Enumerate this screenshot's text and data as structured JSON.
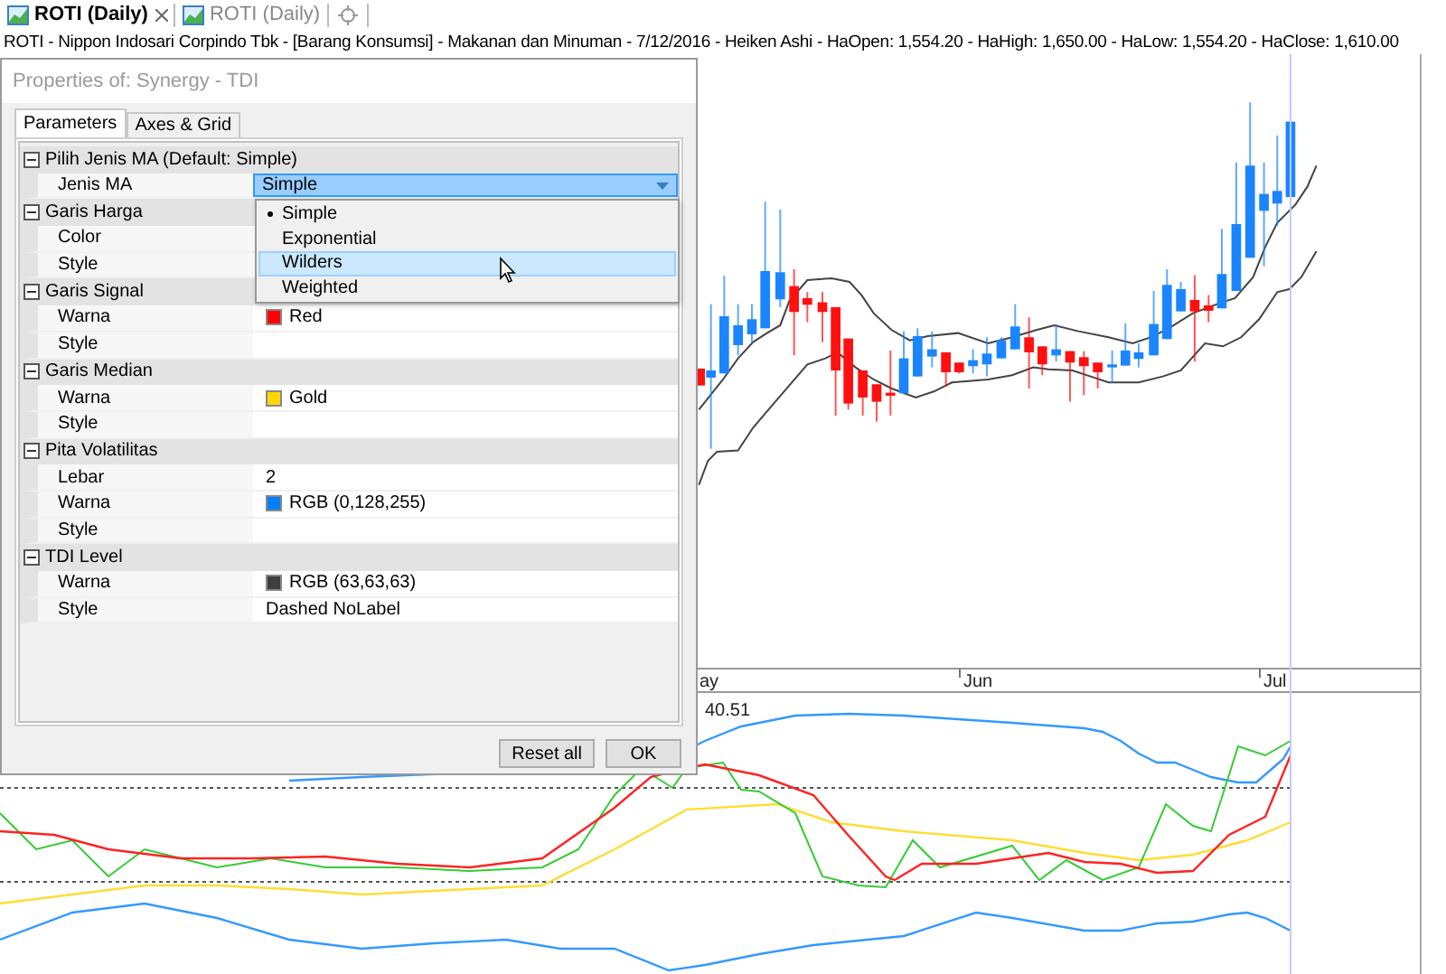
{
  "tabs": [
    {
      "label": "ROTI (Daily)",
      "selected": true,
      "closable": true
    },
    {
      "label": "ROTI (Daily)",
      "selected": false,
      "closable": false
    }
  ],
  "chart_title": "ROTI - Nippon Indosari Corpindo Tbk - [Barang Konsumsi] - Makanan dan Minuman - 7/12/2016 - Heiken Ashi - HaOpen: 1,554.20  - HaHigh: 1,650.00 - HaLow: 1,554.20 - HaClose: 1,610.00",
  "time_axis": {
    "labels": [
      "ay",
      "Jun",
      "Jul"
    ]
  },
  "indicator_panel": {
    "reading": "40.51"
  },
  "dialog": {
    "title": "Properties of: Synergy - TDI",
    "tabs": [
      {
        "label": "Parameters",
        "selected": true
      },
      {
        "label": "Axes & Grid",
        "selected": false
      }
    ],
    "groups": [
      {
        "title": "Pilih Jenis MA (Default: Simple)",
        "expanded": true,
        "rows": [
          {
            "label": "Jenis MA",
            "kind": "dropdown",
            "value": "Simple",
            "open": true
          }
        ]
      },
      {
        "title": "Garis Harga",
        "expanded": true,
        "rows": [
          {
            "label": "Color",
            "kind": "text"
          },
          {
            "label": "Style",
            "kind": "text"
          }
        ]
      },
      {
        "title": "Garis Signal",
        "expanded": true,
        "rows": [
          {
            "label": "Warna",
            "kind": "color",
            "value": "Red",
            "color": "#ff0000"
          },
          {
            "label": "Style",
            "kind": "text"
          }
        ]
      },
      {
        "title": "Garis Median",
        "expanded": true,
        "rows": [
          {
            "label": "Warna",
            "kind": "color",
            "value": "Gold",
            "color": "#ffd700"
          },
          {
            "label": "Style",
            "kind": "text"
          }
        ]
      },
      {
        "title": "Pita Volatilitas",
        "expanded": true,
        "rows": [
          {
            "label": "Lebar",
            "kind": "text",
            "value": "2"
          },
          {
            "label": "Warna",
            "kind": "color",
            "value": "RGB (0,128,255)",
            "color": "#0080ff"
          },
          {
            "label": "Style",
            "kind": "text"
          }
        ]
      },
      {
        "title": "TDI Level",
        "expanded": true,
        "rows": [
          {
            "label": "Warna",
            "kind": "color",
            "value": "RGB (63,63,63)",
            "color": "#3f3f3f"
          },
          {
            "label": "Style",
            "kind": "text",
            "value": "Dashed NoLabel"
          }
        ]
      }
    ],
    "dropdown_options": [
      {
        "label": "Simple",
        "current": true,
        "selected": false
      },
      {
        "label": "Exponential",
        "current": false,
        "selected": false
      },
      {
        "label": "Wilders",
        "current": false,
        "selected": true
      },
      {
        "label": "Weighted",
        "current": false,
        "selected": false
      }
    ],
    "buttons": [
      "Reset all",
      "OK"
    ]
  }
}
